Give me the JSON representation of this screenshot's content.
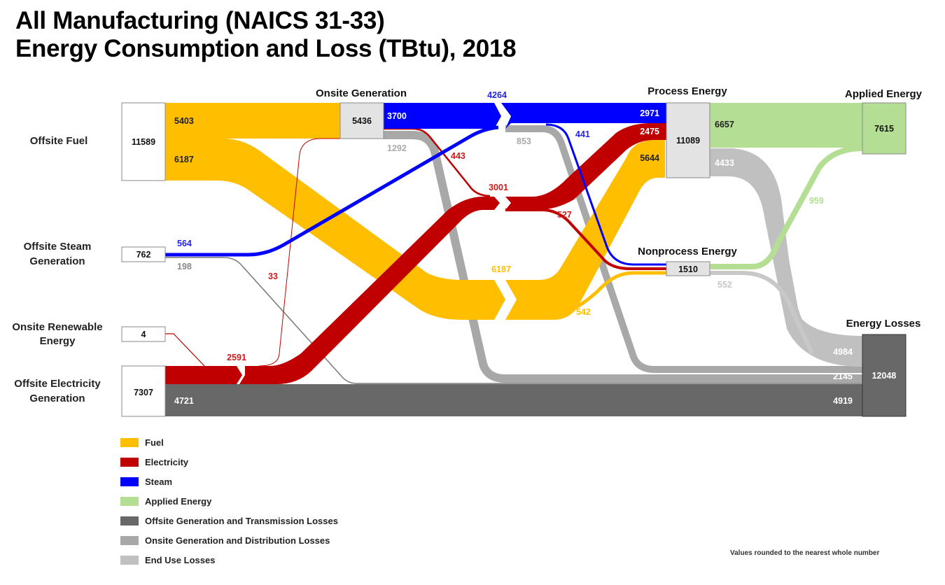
{
  "title": {
    "line1": "All Manufacturing (NAICS 31-33)",
    "line2": "Energy Consumption and Loss (TBtu), 2018"
  },
  "colors": {
    "fuel": "#FFBF00",
    "electricity": "#C00000",
    "steam": "#0000FF",
    "applied": "#B3DE93",
    "offsite_loss": "#686868",
    "onsite_loss": "#A8A8A8",
    "enduse_loss": "#C0C0C0"
  },
  "chart_data": {
    "type": "sankey",
    "title": "All Manufacturing (NAICS 31-33) Energy Consumption and Loss (TBtu), 2018",
    "units": "TBtu",
    "nodes": [
      {
        "id": "offsite_fuel",
        "label": "Offsite Fuel",
        "value": 11589
      },
      {
        "id": "offsite_steam",
        "label": "Offsite Steam Generation",
        "value": 762
      },
      {
        "id": "onsite_renewable",
        "label": "Onsite Renewable Energy",
        "value": 4
      },
      {
        "id": "offsite_electricity",
        "label": "Offsite Electricity Generation",
        "value": 7307
      },
      {
        "id": "onsite_generation",
        "label": "Onsite Generation",
        "value": 5436
      },
      {
        "id": "process_energy",
        "label": "Process Energy",
        "value": 11089
      },
      {
        "id": "nonprocess_energy",
        "label": "Nonprocess Energy",
        "value": 1510
      },
      {
        "id": "applied_energy",
        "label": "Applied Energy",
        "value": 7615
      },
      {
        "id": "energy_losses",
        "label": "Energy Losses",
        "value": 12048
      }
    ],
    "links": [
      {
        "from": "offsite_fuel",
        "to": "onsite_generation",
        "type": "fuel",
        "value": 5403
      },
      {
        "from": "offsite_fuel",
        "to": "end_use_fuel",
        "type": "fuel",
        "value": 6187
      },
      {
        "from": "end_use_fuel",
        "to": "process_energy",
        "type": "fuel",
        "value": 5644
      },
      {
        "from": "end_use_fuel",
        "to": "nonprocess_energy",
        "type": "fuel",
        "value": 542
      },
      {
        "from": "onsite_generation",
        "to": "steam_bus",
        "type": "steam",
        "value": 3700
      },
      {
        "from": "offsite_steam",
        "to": "steam_bus",
        "type": "steam",
        "value": 564
      },
      {
        "from": "steam_bus",
        "to": "process_energy",
        "type": "steam",
        "value": 2971
      },
      {
        "from": "steam_bus",
        "to": "nonprocess_energy",
        "type": "steam",
        "value": 441
      },
      {
        "from": "steam_bus",
        "to": "energy_losses",
        "type": "onsite_loss",
        "value": 853
      },
      {
        "from": "offsite_steam",
        "to": "energy_losses",
        "type": "offsite_loss",
        "value": 198
      },
      {
        "from": "onsite_generation",
        "to": "energy_losses",
        "type": "onsite_loss",
        "value": 1292
      },
      {
        "from": "onsite_generation",
        "to": "electricity_bus",
        "type": "electricity",
        "value": 443
      },
      {
        "from": "offsite_electricity",
        "to": "electricity_bus",
        "type": "electricity",
        "value": 2591
      },
      {
        "from": "electricity_bus",
        "to": "onsite_generation",
        "type": "electricity",
        "value": 33
      },
      {
        "from": "onsite_renewable",
        "to": "electricity_bus",
        "type": "electricity",
        "value": 4
      },
      {
        "from": "electricity_bus",
        "to": "end_use_electricity",
        "type": "electricity",
        "value": 3001
      },
      {
        "from": "end_use_electricity",
        "to": "process_energy",
        "type": "electricity",
        "value": 2475
      },
      {
        "from": "end_use_electricity",
        "to": "nonprocess_energy",
        "type": "electricity",
        "value": 527
      },
      {
        "from": "offsite_electricity",
        "to": "energy_losses",
        "type": "offsite_loss",
        "value": 4721
      },
      {
        "from": "process_energy",
        "to": "applied_energy",
        "type": "applied",
        "value": 6657
      },
      {
        "from": "process_energy",
        "to": "energy_losses",
        "type": "enduse_loss",
        "value": 4433
      },
      {
        "from": "nonprocess_energy",
        "to": "applied_energy",
        "type": "applied",
        "value": 959
      },
      {
        "from": "nonprocess_energy",
        "to": "energy_losses",
        "type": "enduse_loss",
        "value": 552
      }
    ],
    "loss_totals": [
      {
        "label": "End Use Losses",
        "value": 4984
      },
      {
        "label": "Onsite Generation and Distribution Losses",
        "value": 2145
      },
      {
        "label": "Offsite Generation and Transmission Losses",
        "value": 4919
      }
    ],
    "bus_totals": {
      "steam": 4264,
      "electricity": 3001,
      "fuel_end_use": 6187
    }
  },
  "labels": {
    "offsite_fuel": "Offsite Fuel",
    "offsite_steam_1": "Offsite Steam",
    "offsite_steam_2": "Generation",
    "onsite_renewable_1": "Onsite Renewable",
    "onsite_renewable_2": "Energy",
    "offsite_elec_1": "Offsite Electricity",
    "offsite_elec_2": "Generation",
    "onsite_generation": "Onsite Generation",
    "process_energy": "Process Energy",
    "nonprocess_energy": "Nonprocess Energy",
    "applied_energy": "Applied Energy",
    "energy_losses": "Energy Losses"
  },
  "values": {
    "offsite_fuel": "11589",
    "offsite_steam": "762",
    "onsite_renewable": "4",
    "offsite_elec": "7307",
    "onsite_generation": "5436",
    "process_energy": "11089",
    "nonprocess_energy": "1510",
    "applied_energy": "7615",
    "energy_losses": "12048",
    "fuel_to_onsite": "5403",
    "fuel_end_use_out": "6187",
    "steam_onsite": "3700",
    "steam_bus": "4264",
    "steam_to_process": "2971",
    "steam_to_nonprocess": "441",
    "steam_loss": "853",
    "onsite_loss": "1292",
    "elec_from_onsite": "443",
    "elec_bus": "3001",
    "elec_to_process": "2475",
    "elec_to_nonprocess": "527",
    "elec_offsite": "2591",
    "elec_to_onsite": "33",
    "offsite_steam_out": "564",
    "offsite_steam_loss": "198",
    "offsite_elec_loss": "4721",
    "fuel_mid": "6187",
    "fuel_to_process": "5644",
    "fuel_to_nonprocess": "542",
    "process_to_applied": "6657",
    "process_loss": "4433",
    "nonprocess_to_applied": "959",
    "nonprocess_loss": "552",
    "loss_enduse": "4984",
    "loss_onsite": "2145",
    "loss_offsite": "4919"
  },
  "legend": [
    {
      "label": "Fuel",
      "color": "#FFBF00"
    },
    {
      "label": "Electricity",
      "color": "#C00000"
    },
    {
      "label": "Steam",
      "color": "#0000FF"
    },
    {
      "label": "Applied Energy",
      "color": "#B3DE93"
    },
    {
      "label": "Offsite Generation and Transmission Losses",
      "color": "#686868"
    },
    {
      "label": "Onsite Generation and Distribution Losses",
      "color": "#A8A8A8"
    },
    {
      "label": "End Use Losses",
      "color": "#C0C0C0"
    }
  ],
  "footnote": "Values rounded to the nearest whole number"
}
